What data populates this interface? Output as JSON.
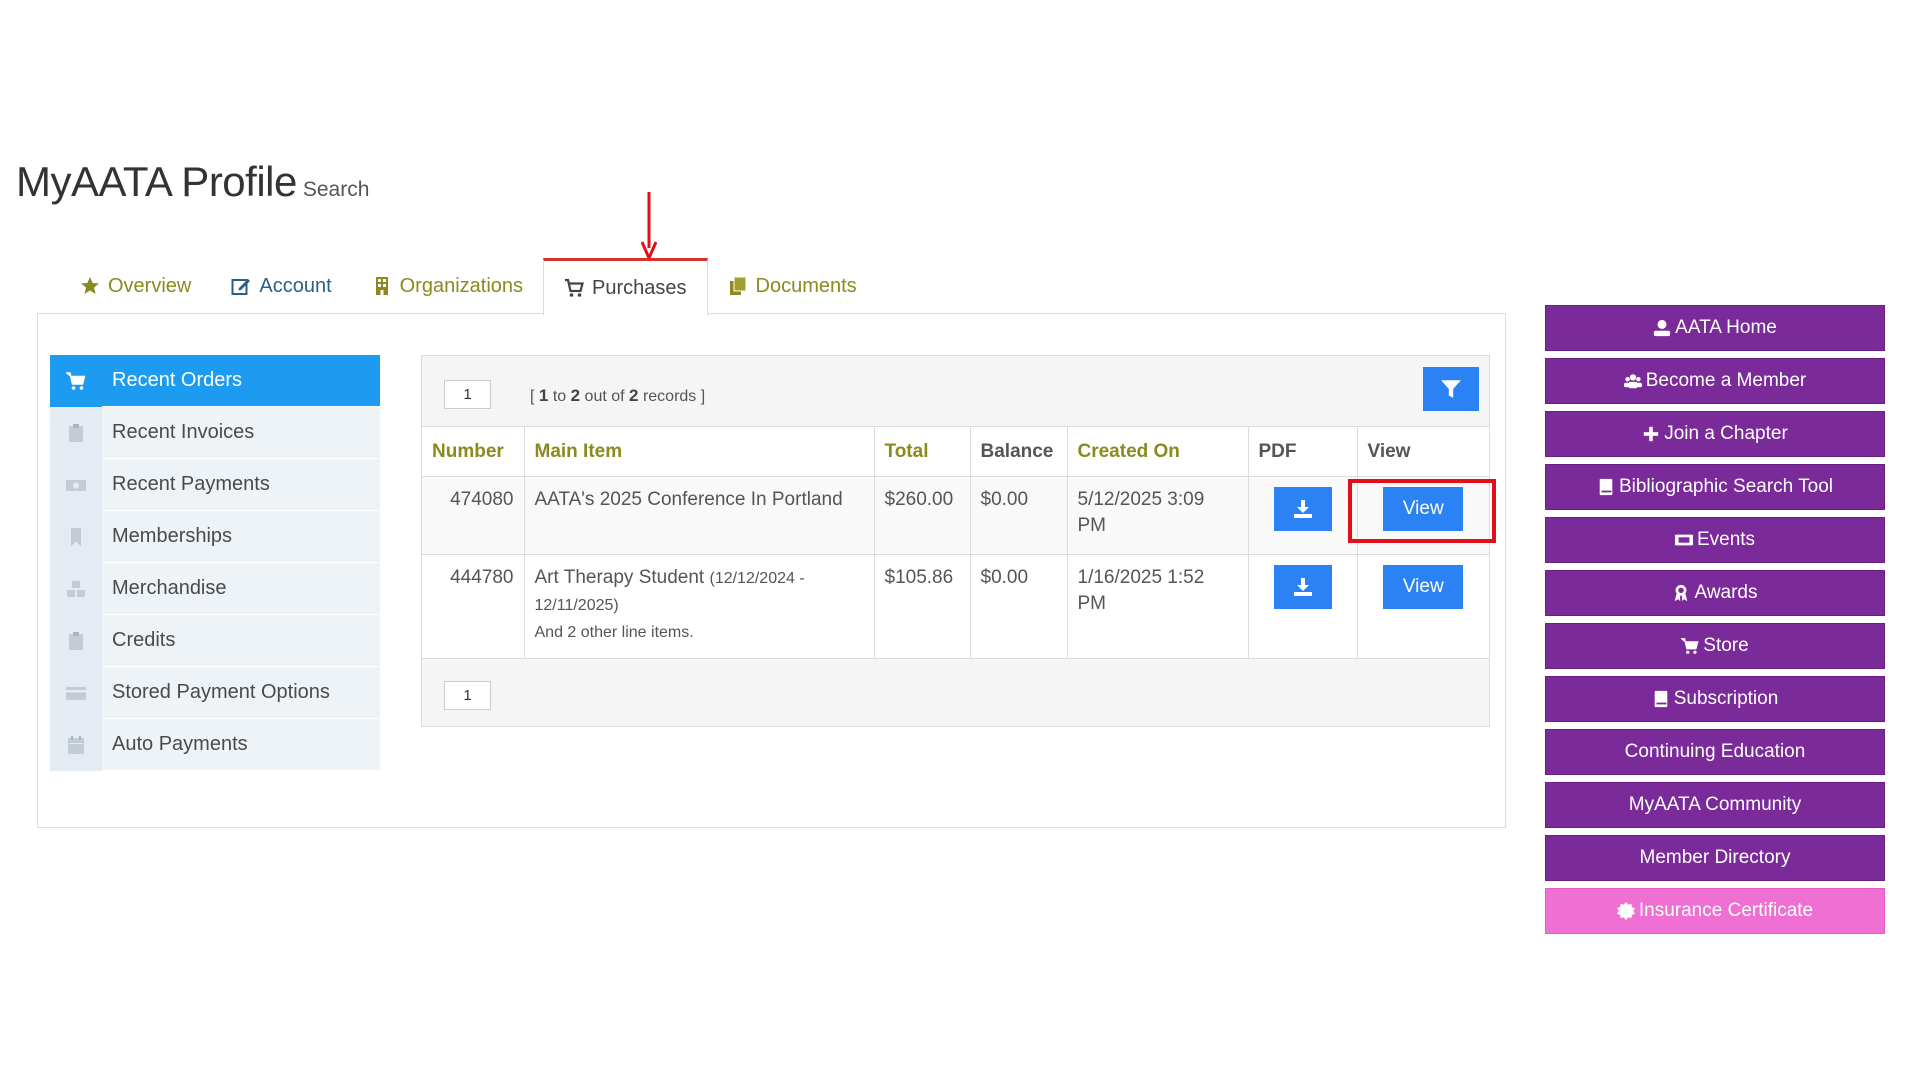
{
  "page": {
    "title": "MyAATA Profile",
    "subtitle": "Search"
  },
  "tabs": [
    {
      "label": "Overview",
      "icon": "star-icon"
    },
    {
      "label": "Account",
      "icon": "edit-icon"
    },
    {
      "label": "Organizations",
      "icon": "building-icon"
    },
    {
      "label": "Purchases",
      "icon": "cart-icon",
      "active": true
    },
    {
      "label": "Documents",
      "icon": "documents-icon"
    }
  ],
  "sidebar": {
    "items": [
      {
        "label": "Recent Orders",
        "icon": "cart-icon",
        "active": true
      },
      {
        "label": "Recent Invoices",
        "icon": "clipboard-icon"
      },
      {
        "label": "Recent Payments",
        "icon": "money-icon"
      },
      {
        "label": "Memberships",
        "icon": "bookmark-icon"
      },
      {
        "label": "Merchandise",
        "icon": "cubes-icon"
      },
      {
        "label": "Credits",
        "icon": "clipboard-icon"
      },
      {
        "label": "Stored Payment Options",
        "icon": "credit-card-icon"
      },
      {
        "label": "Auto Payments",
        "icon": "calendar-icon"
      }
    ]
  },
  "orders": {
    "page_top": "1",
    "page_bottom": "1",
    "records": {
      "open": "[",
      "from": "1",
      "to_word": "to",
      "to": "2",
      "of_word": "out of",
      "total": "2",
      "suffix": "records",
      "close": "]"
    },
    "columns": [
      "Number",
      "Main Item",
      "Total",
      "Balance",
      "Created On",
      "PDF",
      "View"
    ],
    "rows": [
      {
        "number": "474080",
        "main_item": "AATA's 2025 Conference In Portland",
        "main_item_dates": "",
        "extra": "",
        "total": "$260.00",
        "balance": "$0.00",
        "created_on": "5/12/2025 3:09 PM",
        "view_label": "View"
      },
      {
        "number": "444780",
        "main_item": "Art Therapy Student",
        "main_item_dates": "(12/12/2024 - 12/11/2025)",
        "extra": "And 2 other line items.",
        "total": "$105.86",
        "balance": "$0.00",
        "created_on": "1/16/2025 1:52 PM",
        "view_label": "View"
      }
    ]
  },
  "right_menu": [
    {
      "label": "AATA Home",
      "icon": "user-icon"
    },
    {
      "label": "Become a Member",
      "icon": "users-icon"
    },
    {
      "label": "Join a Chapter",
      "icon": "plus-icon"
    },
    {
      "label": "Bibliographic Search Tool",
      "icon": "book-icon"
    },
    {
      "label": "Events",
      "icon": "ticket-icon"
    },
    {
      "label": "Awards",
      "icon": "award-icon"
    },
    {
      "label": "Store",
      "icon": "cart-icon"
    },
    {
      "label": "Subscription",
      "icon": "book-icon"
    },
    {
      "label": "Continuing Education",
      "icon": ""
    },
    {
      "label": "MyAATA Community",
      "icon": ""
    },
    {
      "label": "Member Directory",
      "icon": ""
    },
    {
      "label": "Insurance Certificate",
      "icon": "certificate-icon",
      "pink": true
    }
  ],
  "colors": {
    "accent_blue": "#2b82f5",
    "sidebar_active": "#1d9bf0",
    "purple": "#7b2a9a",
    "pink": "#f06fd2",
    "olive_text": "#8a8a1e",
    "highlight_red": "#e0101a"
  }
}
